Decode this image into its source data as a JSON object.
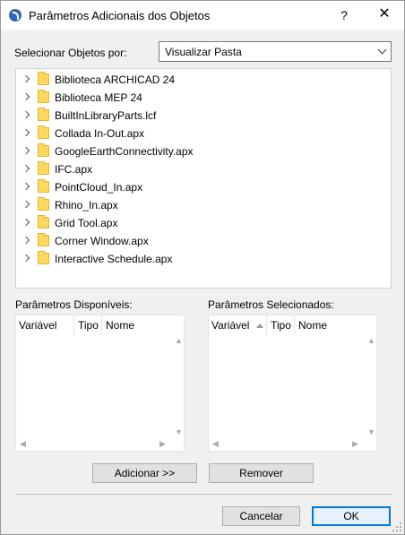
{
  "window": {
    "title": "Parâmetros Adicionais dos Objetos",
    "help_glyph": "?",
    "close_glyph": "✕"
  },
  "select_by": {
    "label": "Selecionar Objetos por:",
    "value": "Visualizar Pasta"
  },
  "tree": {
    "items": [
      "Biblioteca ARCHICAD 24",
      "Biblioteca MEP 24",
      "BuiltInLibraryParts.lcf",
      "Collada In-Out.apx",
      "GoogleEarthConnectivity.apx",
      "IFC.apx",
      "PointCloud_In.apx",
      "Rhino_In.apx",
      "Grid Tool.apx",
      "Corner Window.apx",
      "Interactive Schedule.apx"
    ]
  },
  "available": {
    "label": "Parâmetros Disponíveis:",
    "columns": [
      "Variável",
      "Tipo",
      "Nome"
    ]
  },
  "selected": {
    "label": "Parâmetros Selecionados:",
    "columns": [
      "Variável",
      "Tipo",
      "Nome"
    ]
  },
  "actions": {
    "add_label": "Adicionar >>",
    "remove_label": "Remover"
  },
  "footer": {
    "cancel_label": "Cancelar",
    "ok_label": "OK"
  },
  "colors": {
    "accent": "#0078d7",
    "folder": "#ffd95e",
    "app_icon": "#2f66b7"
  }
}
